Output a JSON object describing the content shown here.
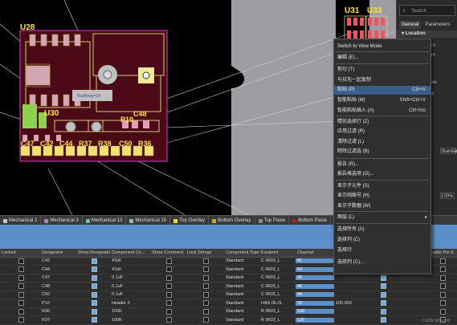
{
  "pcb": {
    "designators": {
      "u28": "U28",
      "u30": "U30",
      "u31": "U31",
      "u33": "U33",
      "c48": "C48",
      "p10": "P10",
      "c47": "C47",
      "c42": "C42",
      "c44": "C44",
      "r37": "R37",
      "r38": "R38",
      "c50": "C50",
      "r36": "R36",
      "roz": "RozBeep=10"
    }
  },
  "properties_panel": {
    "search_placeholder": "Search",
    "tabs": [
      "General",
      "Parameters"
    ],
    "section": "Location",
    "fragments": [
      "m",
      "m",
      "ee",
      "e",
      "Standar",
      "100%"
    ]
  },
  "layer_tabs": [
    {
      "label": "Mechanical 2",
      "color": "#c7c7c7"
    },
    {
      "label": "Mechanical 3",
      "color": "#b77ad7"
    },
    {
      "label": "Mechanical 13",
      "color": "#63c4ad"
    },
    {
      "label": "Mechanical 15",
      "color": "#8cc0a0"
    },
    {
      "label": "Top Overlay",
      "color": "#e6d84a"
    },
    {
      "label": "Bottom Overlay",
      "color": "#c7a34a"
    },
    {
      "label": "Top Paste",
      "color": "#8a8a8a"
    },
    {
      "label": "Bottom Paste",
      "color": "#9a2a2a"
    },
    {
      "label": "Top Solder",
      "color": "#8a3a8a"
    },
    {
      "label": "Bottom S",
      "color": "#b070c0"
    }
  ],
  "grid": {
    "headers": [
      "Locked",
      "Designator",
      "Show Designator",
      "Component Co...",
      "Show Comment",
      "Lock Strings",
      "Component Type",
      "Footprint",
      "Channel",
      "",
      "",
      "",
      "Enable Pin S"
    ],
    "rows": [
      {
        "designator": "C42",
        "comment": "47pF",
        "type": "Standard",
        "footprint": "C 0603_L",
        "channel": "41"
      },
      {
        "designator": "C44",
        "comment": "47pF",
        "type": "Standard",
        "footprint": "C 0603_L",
        "channel": "43"
      },
      {
        "designator": "C47",
        "comment": "0.1uF",
        "type": "Standard",
        "footprint": "C 0603_L",
        "channel": "40"
      },
      {
        "designator": "C48",
        "comment": "0.1uF",
        "type": "Standard",
        "footprint": "C 0603_L",
        "channel": "46"
      },
      {
        "designator": "C50",
        "comment": "0.1uF",
        "type": "Standard",
        "footprint": "C 0603_L",
        "channel": "44"
      },
      {
        "designator": "P10",
        "comment": "Header 2",
        "type": "Standard",
        "footprint": "HAS 06-2L",
        "channel": "70",
        "extra": "100.000"
      },
      {
        "designator": "R36",
        "comment": "100K",
        "type": "Standard",
        "footprint": "R 0603_L",
        "channel": "100"
      },
      {
        "designator": "R37",
        "comment": "100K",
        "type": "Standard",
        "footprint": "R 0603_L",
        "channel": "120"
      },
      {
        "designator": "R38",
        "comment": "100K",
        "type": "Standard",
        "footprint": "R 0603_L",
        "channel": "130"
      }
    ]
  },
  "context_menu": {
    "items": [
      {
        "label": "Switch to View Mode"
      },
      {
        "label": "编辑 (E)..."
      },
      {
        "label": "剪切 (T)"
      },
      {
        "label": "与拉先一起复制"
      },
      {
        "label": "粘贴 (P)",
        "shortcut": "Ctrl+V",
        "hover": true
      },
      {
        "label": "智能粘贴 (M)",
        "shortcut": "Shift+Ctrl+V"
      },
      {
        "label": "智能粘贴插入 (A)",
        "shortcut": "Ctrl+Ins"
      },
      {
        "label": "精优选择行 (Z)"
      },
      {
        "label": "应用过滤 (R)"
      },
      {
        "label": "清除过滤 (L)"
      },
      {
        "label": "除除过滤选 (B)"
      },
      {
        "label": "报告 (R)..."
      },
      {
        "label": "报告格选项 (O)..."
      },
      {
        "label": "显示子元件 (S)"
      },
      {
        "label": "显示网络号 (H)"
      },
      {
        "label": "显示子数据 (W)"
      },
      {
        "label": "图层 (L)",
        "submenu": true
      },
      {
        "label": "选择所有 (A)"
      },
      {
        "label": "选择列 (C)"
      },
      {
        "label": "选择行"
      },
      {
        "label": "选择列 (C)..."
      }
    ]
  },
  "watermark": "CSDN @Bolt-B"
}
